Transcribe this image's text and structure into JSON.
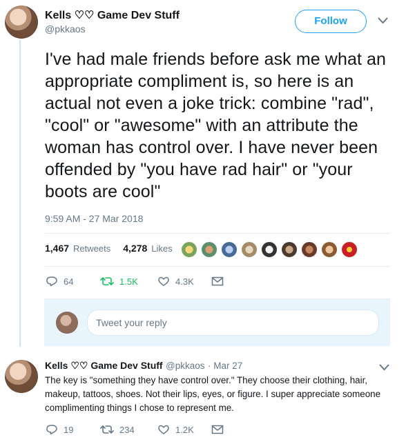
{
  "colors": {
    "accent": "#1da1f2",
    "text": "#14171a",
    "muted": "#657786",
    "border": "#e6ecf0",
    "reply_bg": "#e8f5fd"
  },
  "icons": {
    "more": "chevron-down-icon",
    "reply": "reply-icon",
    "retweet": "retweet-icon",
    "like": "heart-icon",
    "dm": "envelope-icon"
  },
  "main_tweet": {
    "author_name": "Kells ♡♡ Game Dev Stuff",
    "author_handle": "@pkkaos",
    "follow_label": "Follow",
    "text": "I've had male friends before ask me what an appropriate compliment is, so here is an actual not even a joke trick: combine \"rad\", \"cool\" or \"awesome\" with an attribute the woman has control over. I have never been offended by \"you have rad hair\" or \"your boots are cool\"",
    "timestamp": "9:59 AM - 27 Mar 2018",
    "retweets_count": "1,467",
    "retweets_label": "Retweets",
    "likes_count": "4,278",
    "likes_label": "Likes",
    "actions": {
      "reply_count": "64",
      "retweet_count": "1.5K",
      "like_count": "4.3K"
    }
  },
  "reply_box": {
    "placeholder": "Tweet your reply"
  },
  "reply_tweet": {
    "author_name": "Kells ♡♡ Game Dev Stuff",
    "author_handle": "@pkkaos",
    "date": "· Mar 27",
    "text": "The key is \"something they have control over.\" They choose their clothing, hair, makeup, tattoos, shoes. Not their lips, eyes, or figure. I super appreciate someone complimenting things I chose to represent me.",
    "actions": {
      "reply_count": "19",
      "retweet_count": "234",
      "like_count": "1.2K"
    }
  }
}
